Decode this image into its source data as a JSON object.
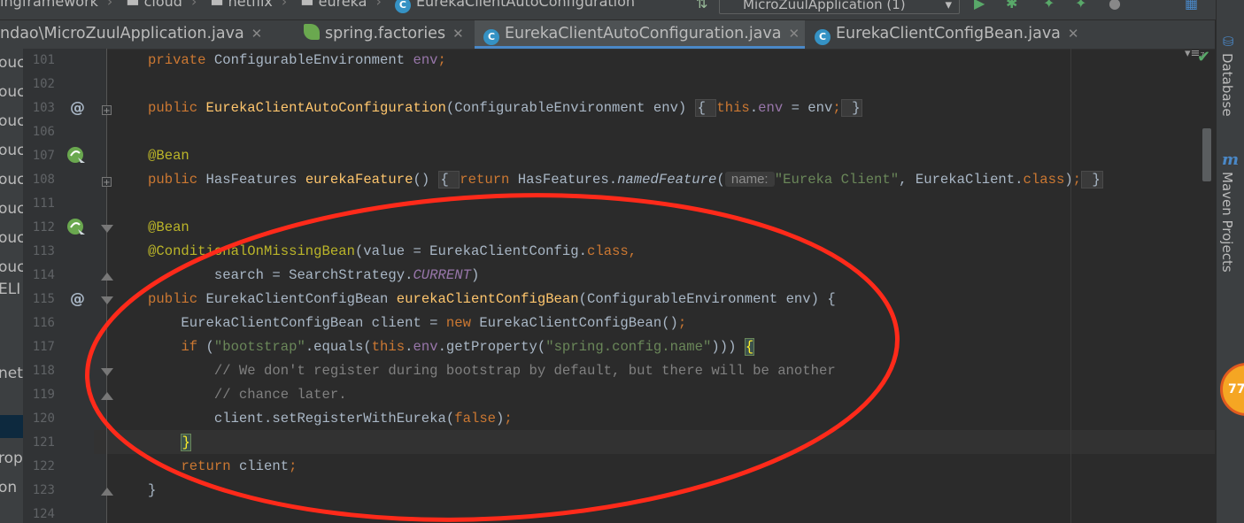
{
  "topbar": {
    "crumbs": [
      "ingframework",
      "cloud",
      "netflix",
      "eureka",
      "EurekaClientAutoConfiguration"
    ],
    "run_config": "MicroZuulApplication (1)"
  },
  "tabs": [
    {
      "label": "ndao\\MicroZuulApplication.java",
      "icon": "class-icon"
    },
    {
      "label": "spring.factories",
      "icon": "spring-leaf-icon"
    },
    {
      "label": "EurekaClientAutoConfiguration.java",
      "icon": "class-icon",
      "active": true
    },
    {
      "label": "EurekaClientConfigBean.java",
      "icon": "class-icon"
    }
  ],
  "tab_menu": "▾≡₇",
  "left_strip": [
    "ouc",
    "ouc",
    "ouc",
    "ouc",
    "ouc",
    "ouc",
    "ouc",
    "ouc",
    "ELI",
    "net",
    "rop",
    "on"
  ],
  "right_tools": [
    "Database",
    "Maven Projects"
  ],
  "badge_text": "77",
  "colors": {
    "keyword": "#cc7832",
    "method": "#ffc66d",
    "string": "#6a8759",
    "annotation": "#bbb529",
    "field": "#9876aa",
    "comment": "#808080",
    "text": "#a9b7c6",
    "annotation_circle": "#ff2a1a",
    "active_tab_underline": "#4a88c7"
  },
  "lines": [
    {
      "no": "101",
      "seg": [
        [
          "kw",
          "private "
        ],
        [
          "",
          "ConfigurableEnvironment "
        ],
        [
          "fd",
          "env"
        ],
        [
          "kw",
          ";"
        ]
      ]
    },
    {
      "no": "102",
      "seg": []
    },
    {
      "no": "103",
      "marker": "@",
      "fold": "+",
      "seg": [
        [
          "kw",
          "public "
        ],
        [
          "fn",
          "EurekaClientAutoConfiguration"
        ],
        [
          "",
          "(ConfigurableEnvironment env) "
        ],
        [
          "fb",
          "{ "
        ],
        [
          "kw",
          "this"
        ],
        [
          "",
          "."
        ],
        [
          "fd",
          "env"
        ],
        [
          "",
          " = env"
        ],
        [
          "kw",
          ";"
        ],
        [
          "fb",
          " }"
        ]
      ]
    },
    {
      "no": "106",
      "seg": []
    },
    {
      "no": "107",
      "bean": true,
      "seg": [
        [
          "an",
          "@Bean"
        ]
      ]
    },
    {
      "no": "108",
      "fold": "+",
      "seg": [
        [
          "kw",
          "public "
        ],
        [
          "",
          "HasFeatures "
        ],
        [
          "fn",
          "eurekaFeature"
        ],
        [
          "",
          "() "
        ],
        [
          "fb",
          "{ "
        ],
        [
          "kw",
          "return "
        ],
        [
          "",
          "HasFeatures."
        ],
        [
          "it",
          "namedFeature"
        ],
        [
          "",
          "("
        ],
        [
          "hint",
          " name: "
        ],
        [
          "st",
          "\"Eureka Client\""
        ],
        [
          "",
          ", EurekaClient."
        ],
        [
          "kw",
          "class"
        ],
        [
          "",
          ")"
        ],
        [
          "kw",
          ";"
        ],
        [
          "fb",
          " }"
        ]
      ]
    },
    {
      "no": "111",
      "seg": []
    },
    {
      "no": "112",
      "bean": true,
      "foldtri": "down",
      "seg": [
        [
          "an",
          "@Bean"
        ]
      ]
    },
    {
      "no": "113",
      "seg": [
        [
          "an",
          "@ConditionalOnMissingBean"
        ],
        [
          "",
          "(value = EurekaClientConfig."
        ],
        [
          "kw",
          "class"
        ],
        [
          "kw",
          ","
        ]
      ]
    },
    {
      "no": "114",
      "foldtri": "up",
      "seg": [
        [
          "",
          "        search = SearchStrategy."
        ],
        [
          "sf",
          "CURRENT"
        ],
        [
          "",
          ")"
        ]
      ]
    },
    {
      "no": "115",
      "marker": "@",
      "foldtri": "down",
      "seg": [
        [
          "kw",
          "public "
        ],
        [
          "",
          "EurekaClientConfigBean "
        ],
        [
          "fn",
          "eurekaClientConfigBean"
        ],
        [
          "",
          "(ConfigurableEnvironment env) {"
        ]
      ]
    },
    {
      "no": "116",
      "seg": [
        [
          "",
          "    EurekaClientConfigBean client = "
        ],
        [
          "kw",
          "new "
        ],
        [
          "",
          "EurekaClientConfigBean()"
        ],
        [
          "kw",
          ";"
        ]
      ]
    },
    {
      "no": "117",
      "seg": [
        [
          "",
          "    "
        ],
        [
          "kw",
          "if "
        ],
        [
          "",
          "("
        ],
        [
          "st",
          "\"bootstrap\""
        ],
        [
          "",
          ".equals("
        ],
        [
          "kw",
          "this"
        ],
        [
          "",
          "."
        ],
        [
          "fd",
          "env"
        ],
        [
          "",
          ".getProperty("
        ],
        [
          "st",
          "\"spring.config.name\""
        ],
        [
          "",
          "))) "
        ],
        [
          "bh",
          "{"
        ]
      ]
    },
    {
      "no": "118",
      "foldtri": "down",
      "seg": [
        [
          "cm",
          "        // We don't register during bootstrap by default, but there will be another"
        ]
      ]
    },
    {
      "no": "119",
      "foldtri": "up",
      "seg": [
        [
          "cm",
          "        // chance later."
        ]
      ]
    },
    {
      "no": "120",
      "seg": [
        [
          "",
          "        client.setRegisterWithEureka("
        ],
        [
          "kw",
          "false"
        ],
        [
          "",
          ")"
        ],
        [
          "kw",
          ";"
        ]
      ]
    },
    {
      "no": "121",
      "seg": [
        [
          "",
          "    "
        ],
        [
          "bh",
          "}"
        ]
      ]
    },
    {
      "no": "122",
      "seg": [
        [
          "",
          "    "
        ],
        [
          "kw",
          "return "
        ],
        [
          "",
          "client"
        ],
        [
          "kw",
          ";"
        ]
      ]
    },
    {
      "no": "123",
      "foldtri": "up",
      "seg": [
        [
          "",
          "}"
        ]
      ]
    },
    {
      "no": "124",
      "seg": []
    }
  ]
}
